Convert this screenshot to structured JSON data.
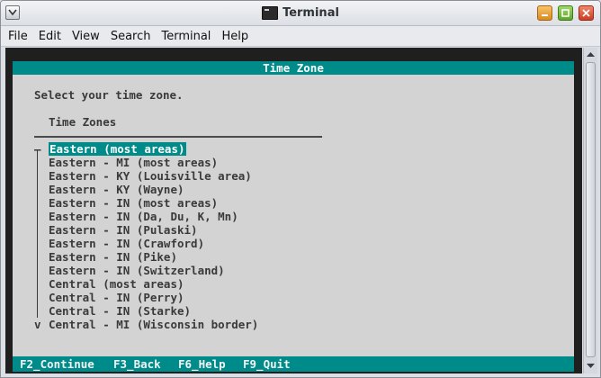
{
  "window": {
    "title": "Terminal"
  },
  "menubar": [
    "File",
    "Edit",
    "View",
    "Search",
    "Terminal",
    "Help"
  ],
  "dialog": {
    "title": "Time Zone",
    "prompt": "Select your time zone.",
    "list_header": "Time Zones",
    "items": [
      {
        "marker": "–",
        "label": "Eastern (most areas)",
        "selected": true
      },
      {
        "marker": "",
        "label": "Eastern - MI (most areas)"
      },
      {
        "marker": "",
        "label": "Eastern - KY (Louisville area)"
      },
      {
        "marker": "",
        "label": "Eastern - KY (Wayne)"
      },
      {
        "marker": "",
        "label": "Eastern - IN (most areas)"
      },
      {
        "marker": "",
        "label": "Eastern - IN (Da, Du, K, Mn)"
      },
      {
        "marker": "",
        "label": "Eastern - IN (Pulaski)"
      },
      {
        "marker": "",
        "label": "Eastern - IN (Crawford)"
      },
      {
        "marker": "",
        "label": "Eastern - IN (Pike)"
      },
      {
        "marker": "",
        "label": "Eastern - IN (Switzerland)"
      },
      {
        "marker": "",
        "label": "Central (most areas)"
      },
      {
        "marker": "",
        "label": "Central - IN (Perry)"
      },
      {
        "marker": "",
        "label": "Central - IN (Starke)"
      },
      {
        "marker": "v",
        "label": "Central - MI (Wisconsin border)"
      }
    ]
  },
  "footer": {
    "keys": [
      "F2_Continue",
      "F3_Back",
      "F6_Help",
      "F9_Quit"
    ]
  },
  "colors": {
    "accent": "#008b8b",
    "dialog_bg": "#d3d3d3",
    "terminal_bg": "#1f1f1f"
  },
  "icons": [
    "window-menu-icon",
    "terminal-app-icon",
    "minimize-icon",
    "maximize-icon",
    "close-icon",
    "scroll-up-icon",
    "scroll-down-icon"
  ]
}
